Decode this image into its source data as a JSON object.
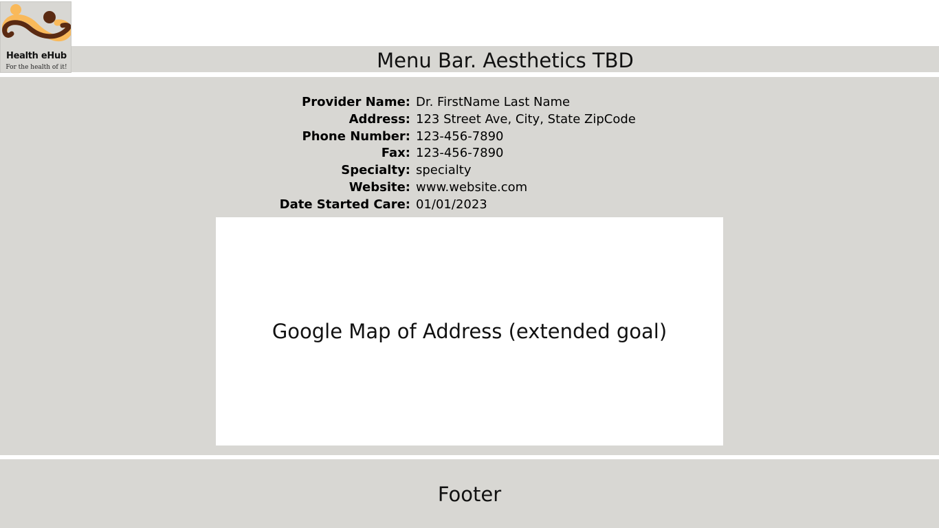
{
  "logo": {
    "title": "Health eHub",
    "tagline": "For the health of it!",
    "colors": {
      "accent": "#f9b95a",
      "brown": "#5a2a12"
    }
  },
  "menu_bar": {
    "text": "Menu Bar. Aesthetics TBD"
  },
  "provider": {
    "fields": [
      {
        "label": "Provider Name:",
        "value": "Dr. FirstName Last Name"
      },
      {
        "label": "Address:",
        "value": "123 Street Ave, City, State ZipCode"
      },
      {
        "label": "Phone Number:",
        "value": "123-456-7890"
      },
      {
        "label": "Fax:",
        "value": "123-456-7890"
      },
      {
        "label": "Specialty:",
        "value": "specialty"
      },
      {
        "label": "Website:",
        "value": "www.website.com"
      },
      {
        "label": "Date Started Care:",
        "value": "01/01/2023"
      }
    ]
  },
  "map": {
    "placeholder_text": "Google Map of Address (extended goal)"
  },
  "footer": {
    "text": "Footer"
  }
}
